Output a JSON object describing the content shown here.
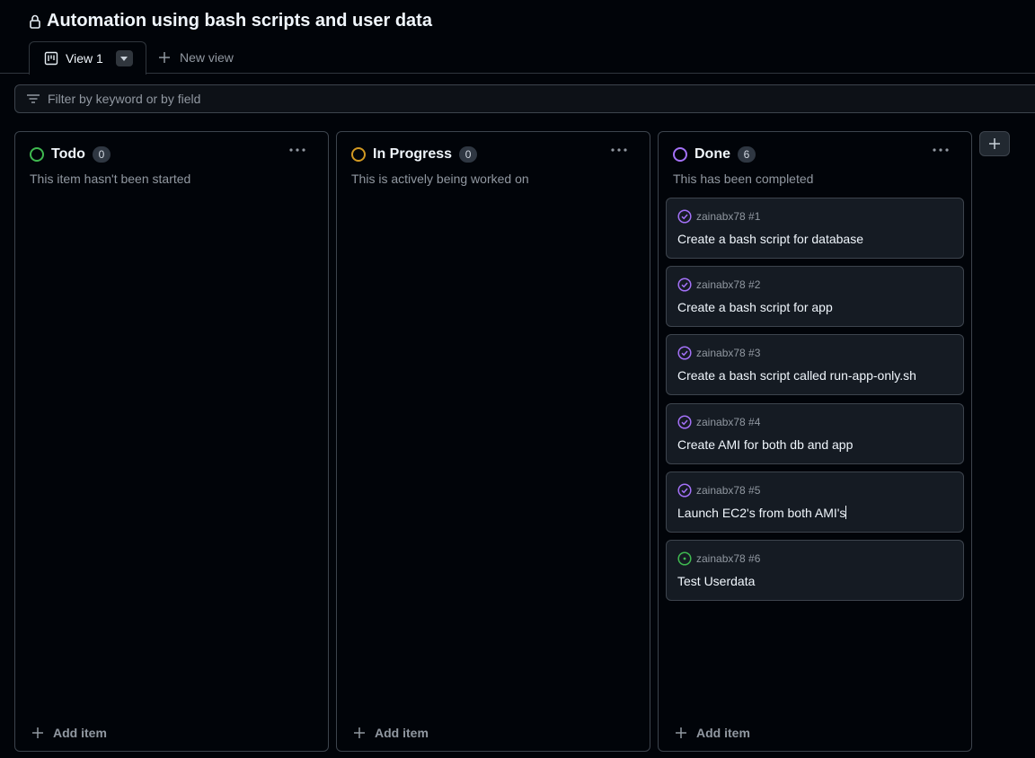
{
  "header": {
    "title": "Automation using bash scripts and user data",
    "tabs": [
      {
        "label": "View 1"
      }
    ],
    "new_view_label": "New view"
  },
  "filter": {
    "placeholder": "Filter by keyword or by field"
  },
  "colors": {
    "todo": "#3fb950",
    "in_progress": "#d29922",
    "done": "#a371f7",
    "open_issue": "#3fb950",
    "closed_issue": "#a371f7"
  },
  "columns": [
    {
      "title": "Todo",
      "count": "0",
      "description": "This item hasn't been started",
      "add_item": "Add item",
      "cards": []
    },
    {
      "title": "In Progress",
      "count": "0",
      "description": "This is actively being worked on",
      "add_item": "Add item",
      "cards": []
    },
    {
      "title": "Done",
      "count": "6",
      "description": "This has been completed",
      "add_item": "Add item",
      "cards": [
        {
          "meta": "zainabx78 #1",
          "title": "Create a bash script for database",
          "status": "closed",
          "icon": "check-circle-icon"
        },
        {
          "meta": "zainabx78 #2",
          "title": "Create a bash script for app",
          "status": "closed",
          "icon": "check-circle-icon"
        },
        {
          "meta": "zainabx78 #3",
          "title": "Create a bash script called run-app-only.sh",
          "status": "closed",
          "icon": "check-circle-icon"
        },
        {
          "meta": "zainabx78 #4",
          "title": "Create AMI for both db and app",
          "status": "closed",
          "icon": "check-circle-icon"
        },
        {
          "meta": "zainabx78 #5",
          "title": "Launch EC2's from both AMI's",
          "status": "closed",
          "icon": "check-circle-icon"
        },
        {
          "meta": "zainabx78 #6",
          "title": "Test Userdata",
          "status": "open",
          "icon": "issue-opened-icon"
        }
      ]
    }
  ]
}
